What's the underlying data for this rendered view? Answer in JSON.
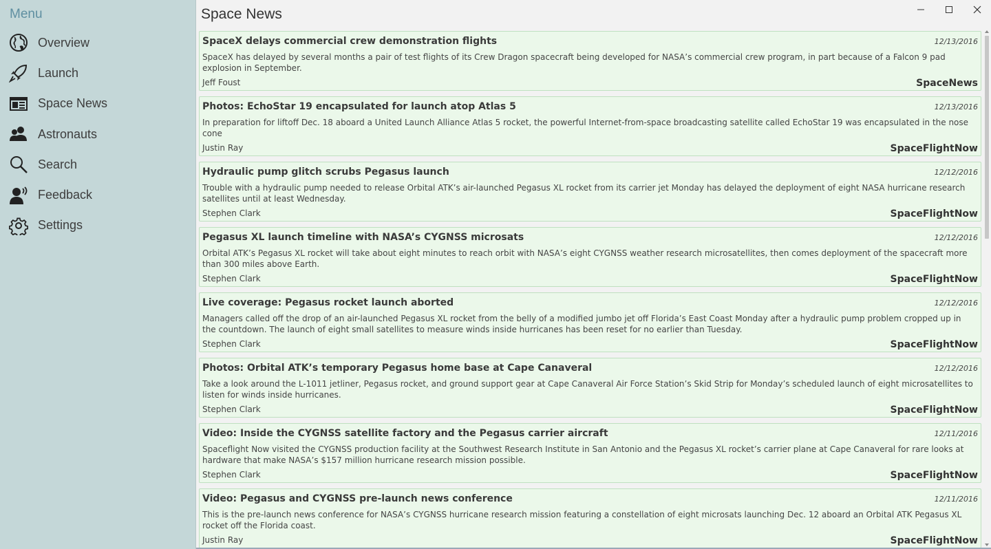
{
  "sidebar": {
    "title": "Menu",
    "items": [
      {
        "label": "Overview",
        "icon": "globe-icon"
      },
      {
        "label": "Launch",
        "icon": "rocket-icon"
      },
      {
        "label": "Space News",
        "icon": "news-icon"
      },
      {
        "label": "Astronauts",
        "icon": "people-icon"
      },
      {
        "label": "Search",
        "icon": "search-icon"
      },
      {
        "label": "Feedback",
        "icon": "feedback-icon"
      },
      {
        "label": "Settings",
        "icon": "gear-icon"
      }
    ]
  },
  "main": {
    "title": "Space News"
  },
  "window": {
    "minimize": "minimize-icon",
    "maximize": "maximize-icon",
    "close": "close-icon"
  },
  "articles": [
    {
      "title": "SpaceX delays commercial crew demonstration flights",
      "date": "12/13/2016",
      "summary": "SpaceX has delayed by several months a pair of test flights of its Crew Dragon spacecraft being developed for NASA’s commercial crew program, in part because of a Falcon 9 pad explosion in September.",
      "author": "Jeff Foust",
      "source": "SpaceNews"
    },
    {
      "title": "Photos: EchoStar 19 encapsulated for launch atop Atlas 5",
      "date": "12/13/2016",
      "summary": "In preparation for liftoff Dec. 18 aboard a United Launch Alliance Atlas 5 rocket, the powerful Internet-from-space broadcasting satellite called EchoStar 19 was encapsulated in the nose cone",
      "author": "Justin Ray",
      "source": "SpaceFlightNow"
    },
    {
      "title": "Hydraulic pump glitch scrubs Pegasus launch",
      "date": "12/12/2016",
      "summary": "Trouble with a hydraulic pump needed to release Orbital ATK’s air-launched Pegasus XL rocket from its carrier jet Monday has delayed the deployment of eight NASA hurricane research satellites until at least Wednesday.",
      "author": "Stephen Clark",
      "source": "SpaceFlightNow"
    },
    {
      "title": "Pegasus XL launch timeline with NASA’s CYGNSS microsats",
      "date": "12/12/2016",
      "summary": "Orbital ATK’s Pegasus XL rocket will take about eight minutes to reach orbit with NASA’s eight CYGNSS weather research microsatellites, then comes deployment of the spacecraft more than 300 miles above Earth.",
      "author": "Stephen Clark",
      "source": "SpaceFlightNow"
    },
    {
      "title": "Live coverage: Pegasus rocket launch aborted",
      "date": "12/12/2016",
      "summary": "Managers called off the drop of an air-launched Pegasus XL rocket from the belly of a modified jumbo jet off Florida’s East Coast Monday after a hydraulic pump problem cropped up in the countdown. The launch of eight small satellites to measure winds inside hurricanes has been reset for no earlier than Tuesday.",
      "author": "Stephen Clark",
      "source": "SpaceFlightNow"
    },
    {
      "title": "Photos: Orbital ATK’s temporary Pegasus home base at Cape Canaveral",
      "date": "12/12/2016",
      "summary": "Take a look around the L-1011 jetliner, Pegasus rocket, and ground support gear at Cape Canaveral Air Force Station’s Skid Strip for Monday’s scheduled launch of eight microsatellites to listen for winds inside hurricanes.",
      "author": "Stephen Clark",
      "source": "SpaceFlightNow"
    },
    {
      "title": "Video: Inside the CYGNSS satellite factory and the Pegasus carrier aircraft",
      "date": "12/11/2016",
      "summary": "Spaceflight Now visited the CYGNSS production facility at the Southwest Research Institute in San Antonio and the Pegasus XL rocket’s carrier plane at Cape Canaveral for rare looks at hardware that make NASA’s $157 million hurricane research mission possible.",
      "author": "Stephen Clark",
      "source": "SpaceFlightNow"
    },
    {
      "title": "Video: Pegasus and CYGNSS pre-launch news conference",
      "date": "12/11/2016",
      "summary": "This is the pre-launch news conference for NASA’s CYGNSS hurricane research mission featuring a constellation of eight microsats launching Dec. 12 aboard an Orbital ATK Pegasus XL rocket off the Florida coast.",
      "author": "Justin Ray",
      "source": "SpaceFlightNow"
    }
  ]
}
